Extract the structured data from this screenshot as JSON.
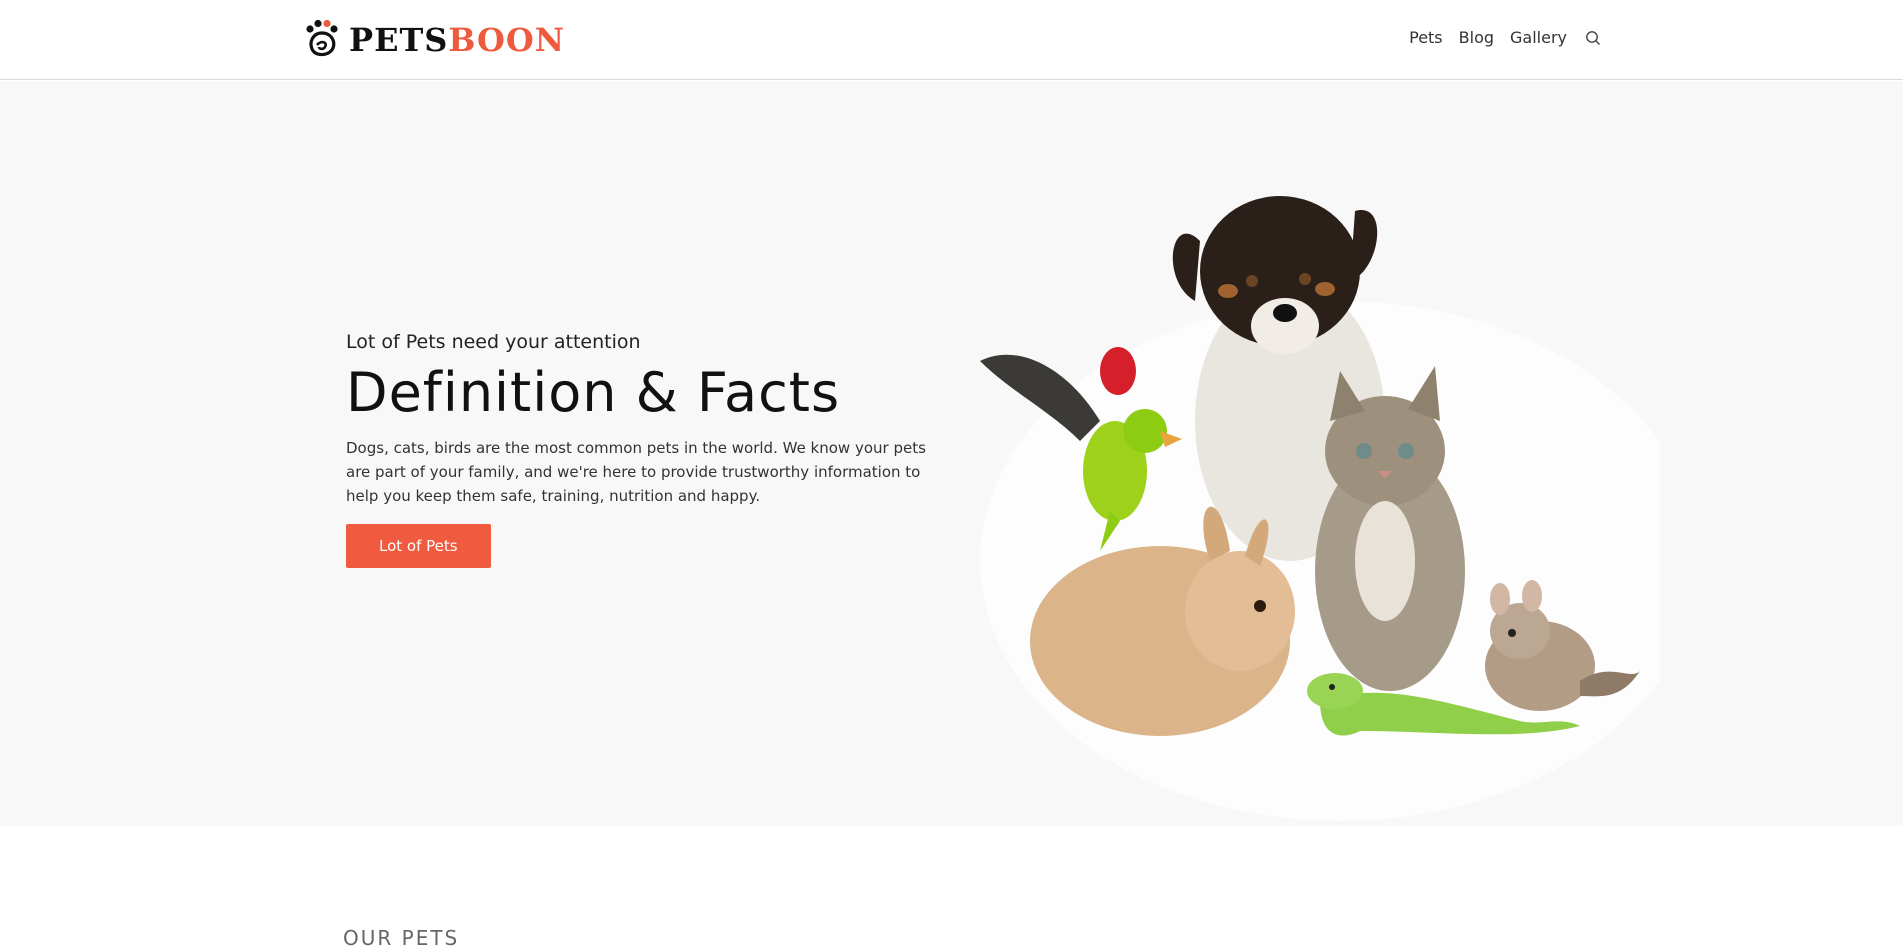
{
  "brand": {
    "part1": "PETS",
    "part2": "BOON",
    "accent_color": "#ef5a3f"
  },
  "nav": {
    "items": [
      "Pets",
      "Blog",
      "Gallery"
    ],
    "search_icon": "search-icon"
  },
  "hero": {
    "eyebrow": "Lot of Pets need your attention",
    "headline": "Definition & Facts",
    "description": "Dogs, cats, birds are the most common pets in the world. We know your pets are part of your family, and we're here to provide trustworthy information to help you keep them safe, training, nutrition and happy.",
    "cta_label": "Lot of Pets",
    "cta_color": "#f05a3f"
  },
  "section": {
    "title": "OUR PETS"
  }
}
